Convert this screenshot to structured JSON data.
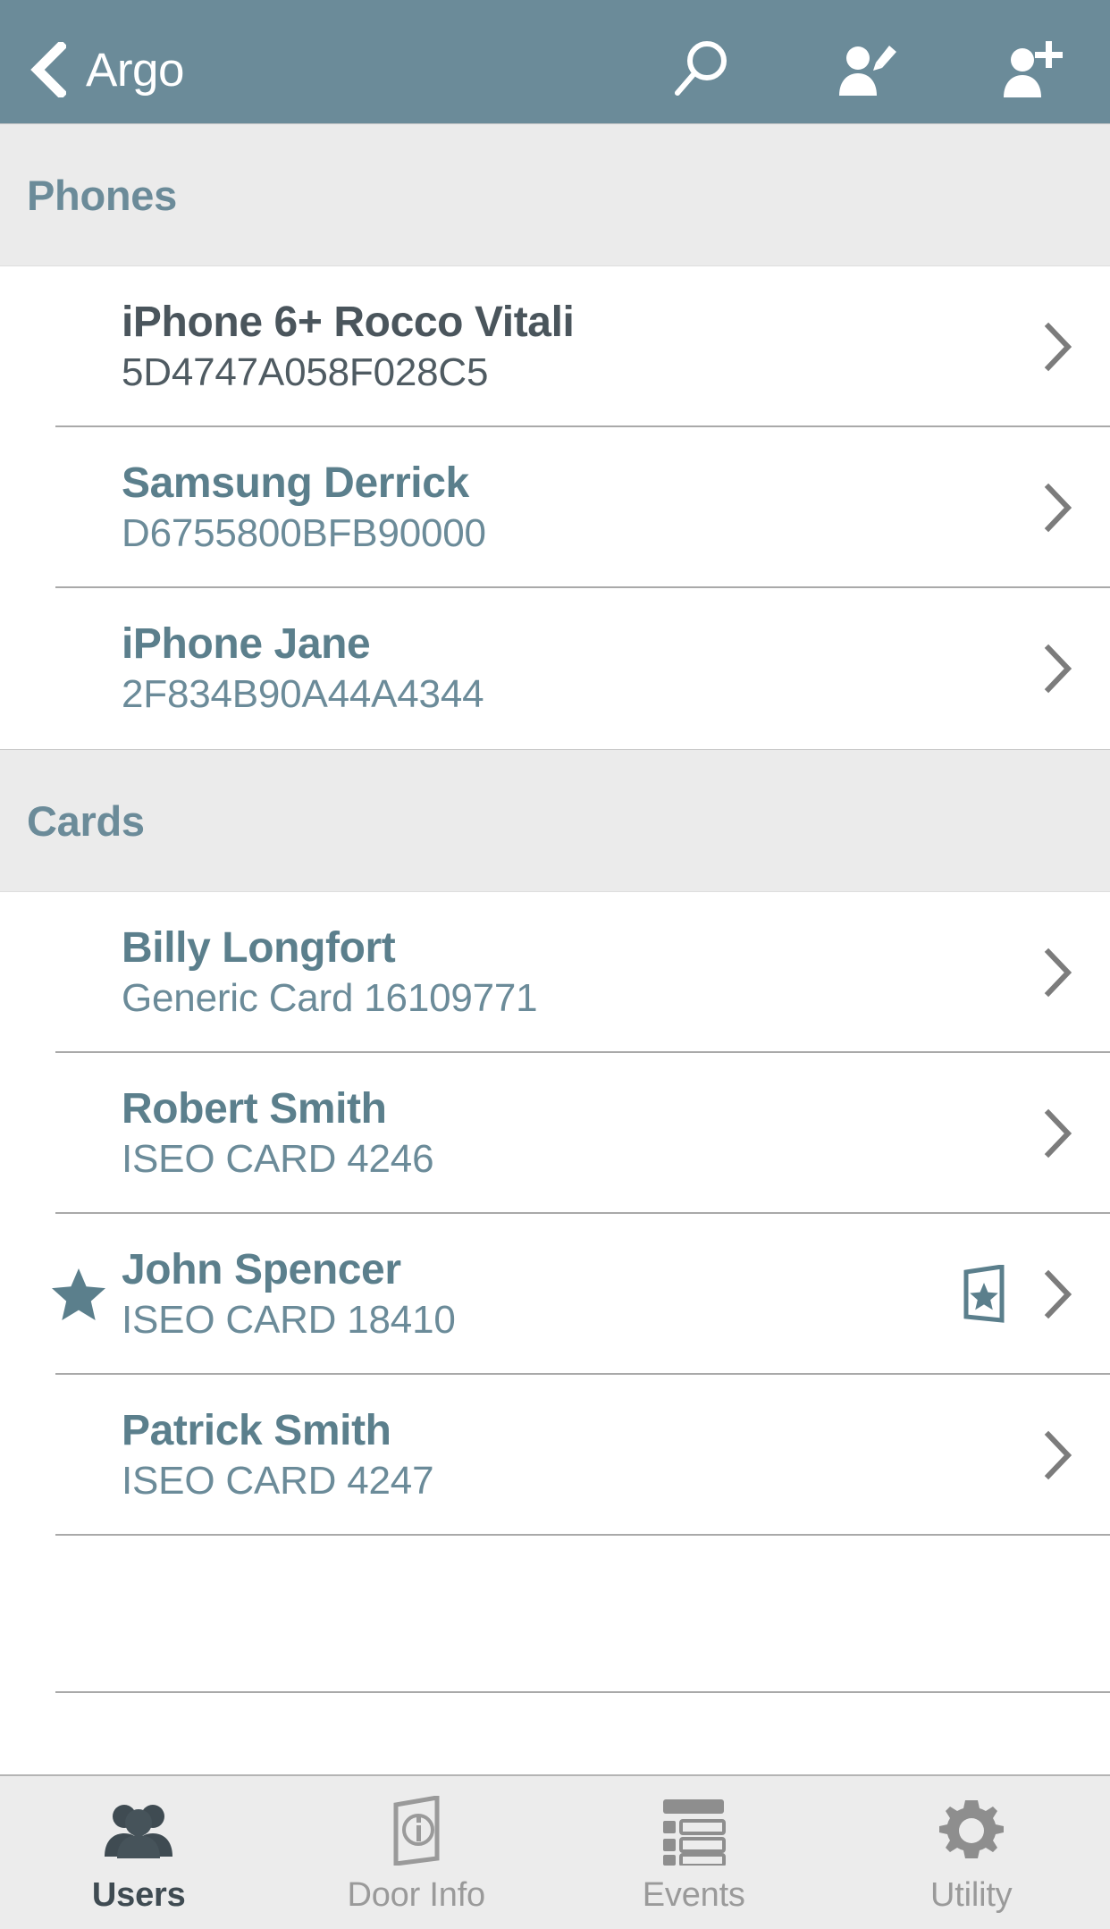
{
  "navbar": {
    "back_label": "Argo",
    "back_icon": "chevron-left-icon",
    "actions": [
      {
        "name": "search-icon",
        "label": "Search"
      },
      {
        "name": "edit-user-icon",
        "label": "Edit User"
      },
      {
        "name": "add-user-icon",
        "label": "Add User"
      }
    ],
    "background_color": "#6b8b99",
    "title_color": "#ffffff"
  },
  "sections": [
    {
      "title": "Phones",
      "rows": [
        {
          "title": "iPhone 6+ Rocco Vitali",
          "subtitle": "5D4747A058F028C5",
          "starred": false,
          "badge": false,
          "emphasis": "dark"
        },
        {
          "title": "Samsung Derrick",
          "subtitle": "D6755800BFB90000",
          "starred": false,
          "badge": false,
          "emphasis": "normal"
        },
        {
          "title": "iPhone Jane",
          "subtitle": "2F834B90A44A4344",
          "starred": false,
          "badge": false,
          "emphasis": "normal"
        }
      ]
    },
    {
      "title": "Cards",
      "rows": [
        {
          "title": "Billy Longfort",
          "subtitle": "Generic Card 16109771",
          "starred": false,
          "badge": false,
          "emphasis": "normal"
        },
        {
          "title": "Robert Smith",
          "subtitle": "ISEO CARD 4246",
          "starred": false,
          "badge": false,
          "emphasis": "normal"
        },
        {
          "title": "John Spencer",
          "subtitle": "ISEO CARD 18410",
          "starred": true,
          "badge": true,
          "emphasis": "normal"
        },
        {
          "title": "Patrick Smith",
          "subtitle": "ISEO CARD 4247",
          "starred": false,
          "badge": false,
          "emphasis": "normal"
        }
      ]
    }
  ],
  "icons": {
    "star": "star-icon",
    "door_star_badge": "door-star-badge-icon",
    "chevron_right": "chevron-right-icon"
  },
  "tabbar": {
    "items": [
      {
        "label": "Users",
        "icon": "users-icon",
        "active": true
      },
      {
        "label": "Door Info",
        "icon": "door-info-icon",
        "active": false
      },
      {
        "label": "Events",
        "icon": "events-list-icon",
        "active": false
      },
      {
        "label": "Utility",
        "icon": "gear-icon",
        "active": false
      }
    ]
  },
  "colors": {
    "accent": "#6b8b99",
    "section_bg": "#ebebeb",
    "row_title": "#5b7f8c",
    "row_title_dark": "#4a555c",
    "tab_active": "#3f4b52",
    "tab_inactive": "#9a9a9a"
  }
}
